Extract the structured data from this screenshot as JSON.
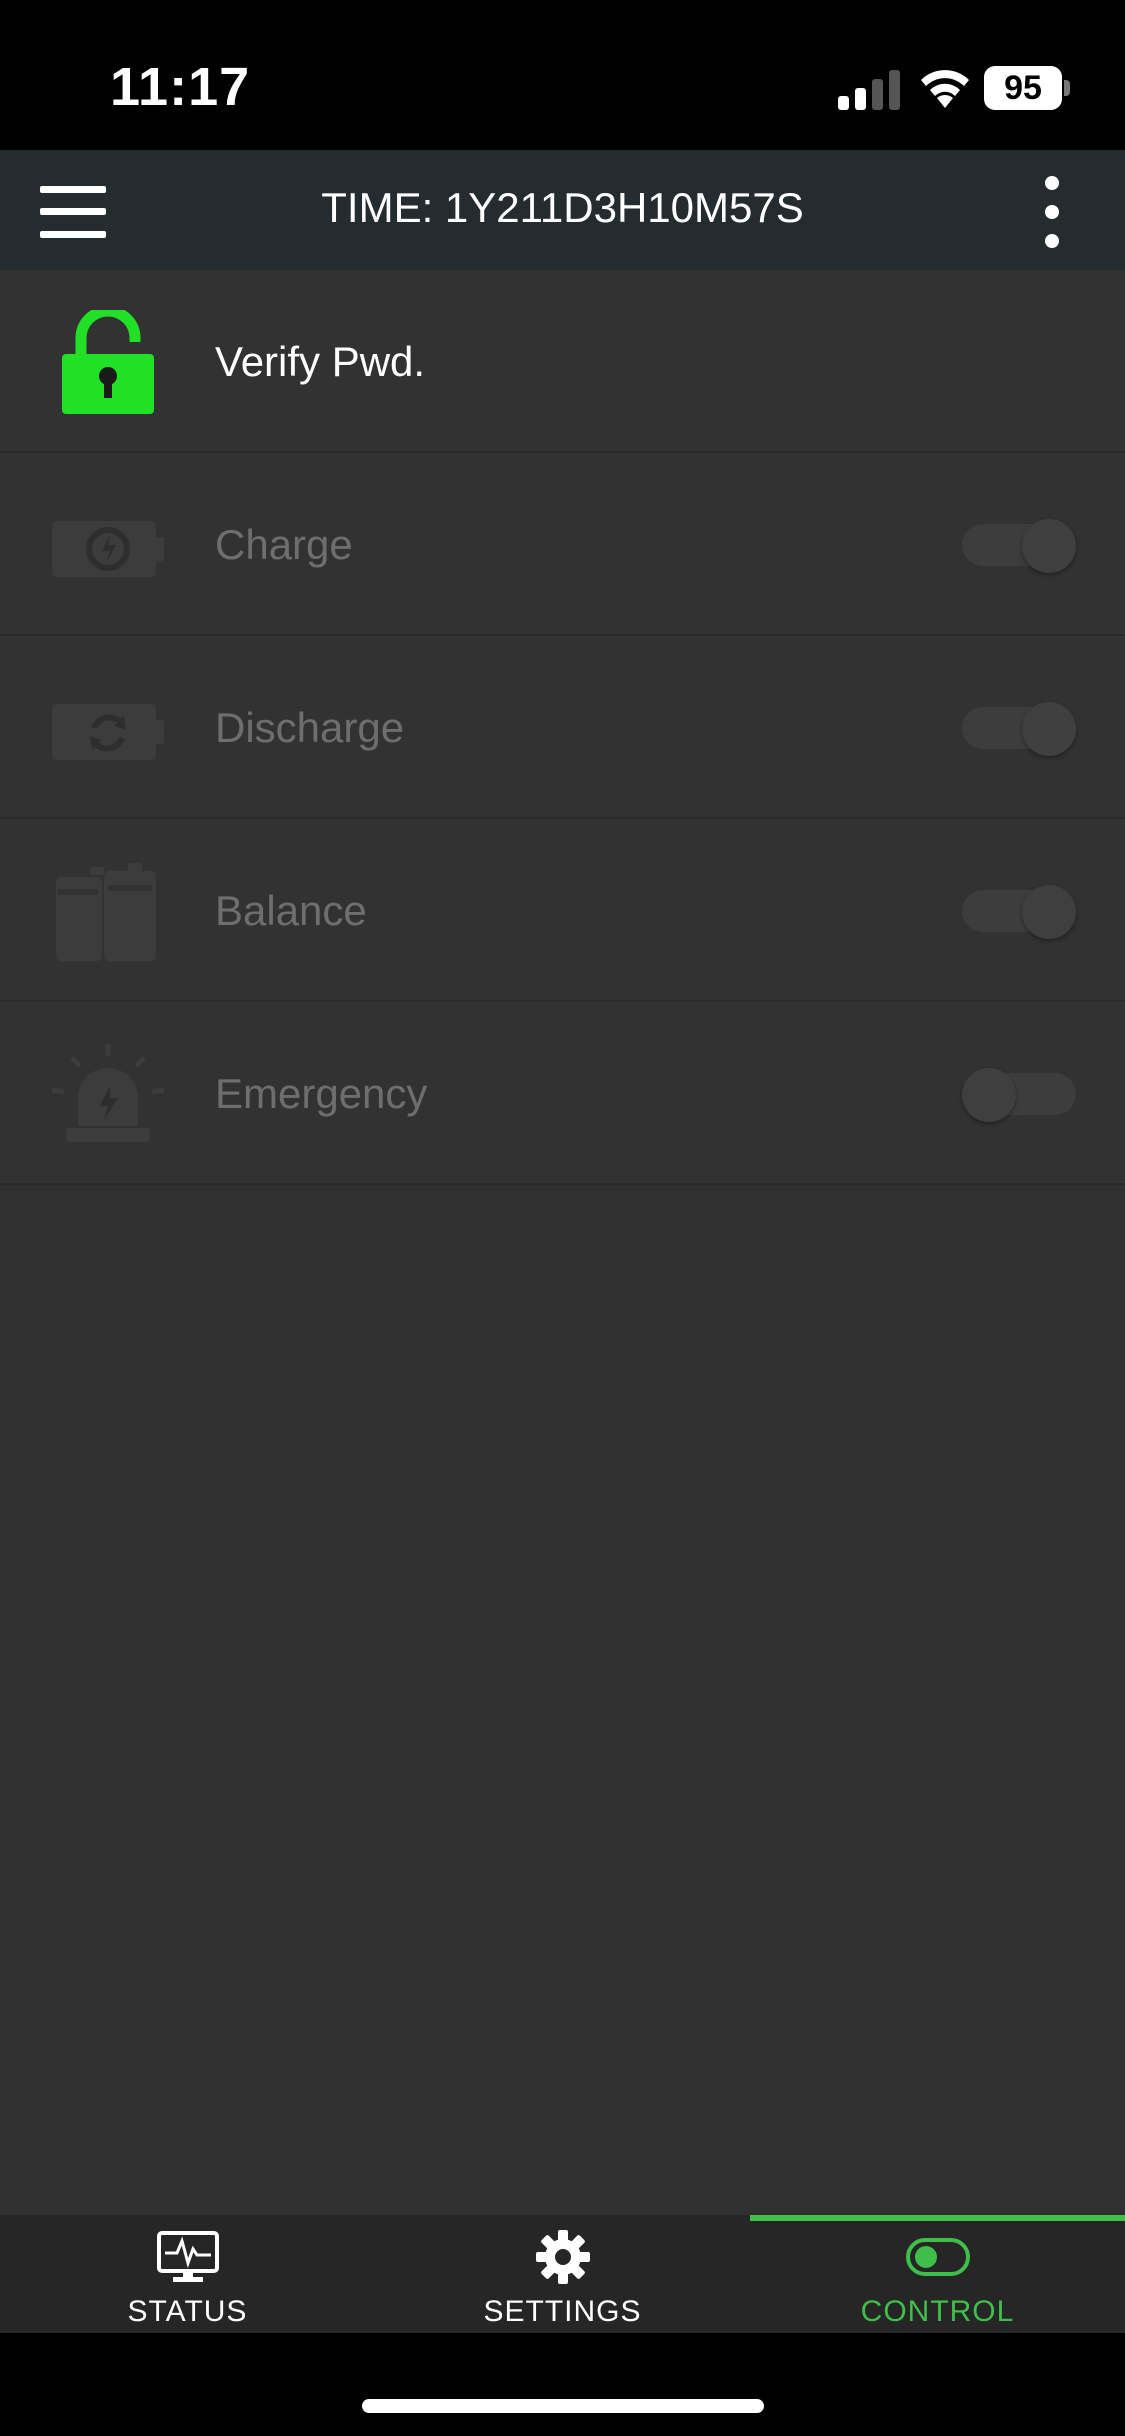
{
  "status_bar": {
    "time": "11:17",
    "battery": "95"
  },
  "header": {
    "title": "TIME: 1Y211D3H10M57S",
    "menu_icon": "hamburger-menu-icon",
    "more_icon": "more-vertical-icon"
  },
  "controls": {
    "verify": {
      "label": "Verify Pwd.",
      "icon": "unlocked-padlock-icon",
      "icon_color": "#22e026"
    },
    "items": [
      {
        "label": "Charge",
        "icon": "battery-charge-icon",
        "enabled": true
      },
      {
        "label": "Discharge",
        "icon": "battery-discharge-icon",
        "enabled": true
      },
      {
        "label": "Balance",
        "icon": "battery-balance-icon",
        "enabled": true
      },
      {
        "label": "Emergency",
        "icon": "emergency-siren-icon",
        "enabled": false
      }
    ]
  },
  "bottom_nav": {
    "tabs": [
      {
        "label": "STATUS",
        "icon": "monitor-pulse-icon"
      },
      {
        "label": "SETTINGS",
        "icon": "gear-icon"
      },
      {
        "label": "CONTROL",
        "icon": "toggle-switch-icon"
      }
    ],
    "active": "CONTROL",
    "accent_color": "#3fbf4a"
  }
}
